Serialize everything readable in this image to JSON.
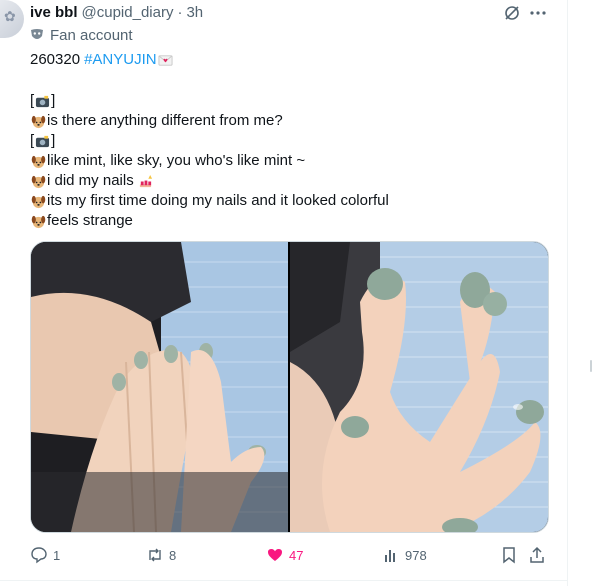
{
  "post": {
    "display_name": "ive bbl",
    "handle": "@cupid_diary",
    "separator": "·",
    "time": "3h",
    "account_label": "Fan account",
    "date_text": "260320",
    "hashtag": "#ANYUJIN",
    "lines": [
      {
        "open": "[",
        "close": "]",
        "icon": "camera-flash-emoji"
      },
      {
        "text": "is there anything different from me?",
        "icon": "puppy-emoji"
      },
      {
        "open": "[",
        "close": "]",
        "icon": "camera-flash-emoji"
      },
      {
        "text": "like mint, like sky, you who's like mint ~",
        "icon": "puppy-emoji"
      },
      {
        "text": "i did my nails",
        "icon": "puppy-emoji",
        "trail_icon": "nail-polish-emoji"
      },
      {
        "text": "its my first time doing my nails and it looked colorful",
        "icon": "puppy-emoji"
      },
      {
        "text": "feels strange",
        "icon": "puppy-emoji"
      }
    ],
    "media": [
      {
        "name": "photo-hand-on-face",
        "description_icon": "photo"
      },
      {
        "name": "photo-hand-spread",
        "description_icon": "photo"
      }
    ]
  },
  "actions": {
    "replies": "1",
    "reposts": "8",
    "likes": "47",
    "views": "978"
  },
  "colors": {
    "accent": "#1d9bf0",
    "like": "#f91880",
    "muted": "#536471",
    "text": "#0f1419",
    "border": "#cfd9de"
  }
}
